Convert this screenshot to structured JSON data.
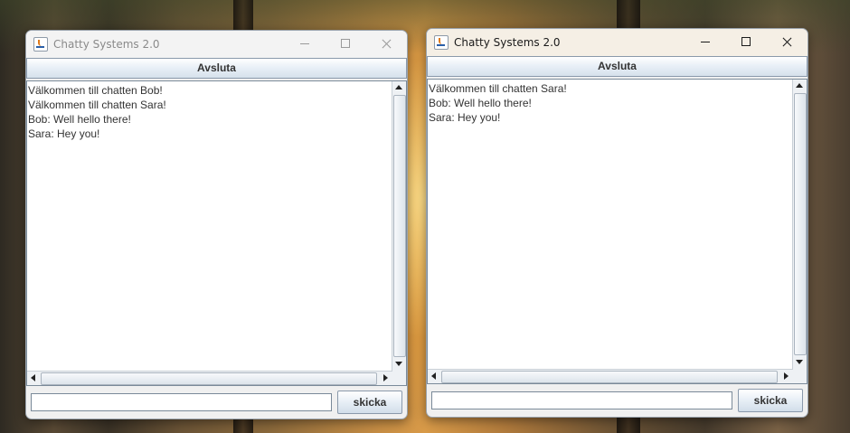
{
  "windows": [
    {
      "title": "Chatty Systems 2.0",
      "exit_label": "Avsluta",
      "messages": [
        "Välkommen till chatten Bob!",
        "Välkommen till chatten Sara!",
        "Bob: Well hello there!",
        "Sara: Hey you!"
      ],
      "input_value": "",
      "send_label": "skicka"
    },
    {
      "title": "Chatty Systems 2.0",
      "exit_label": "Avsluta",
      "messages": [
        "Välkommen till chatten Sara!",
        "Bob: Well hello there!",
        "Sara: Hey you!"
      ],
      "input_value": "",
      "send_label": "skicka"
    }
  ],
  "icons": {
    "app": "java-coffee-cup-icon",
    "minimize": "minimize-icon",
    "maximize": "maximize-icon",
    "close": "close-icon"
  }
}
